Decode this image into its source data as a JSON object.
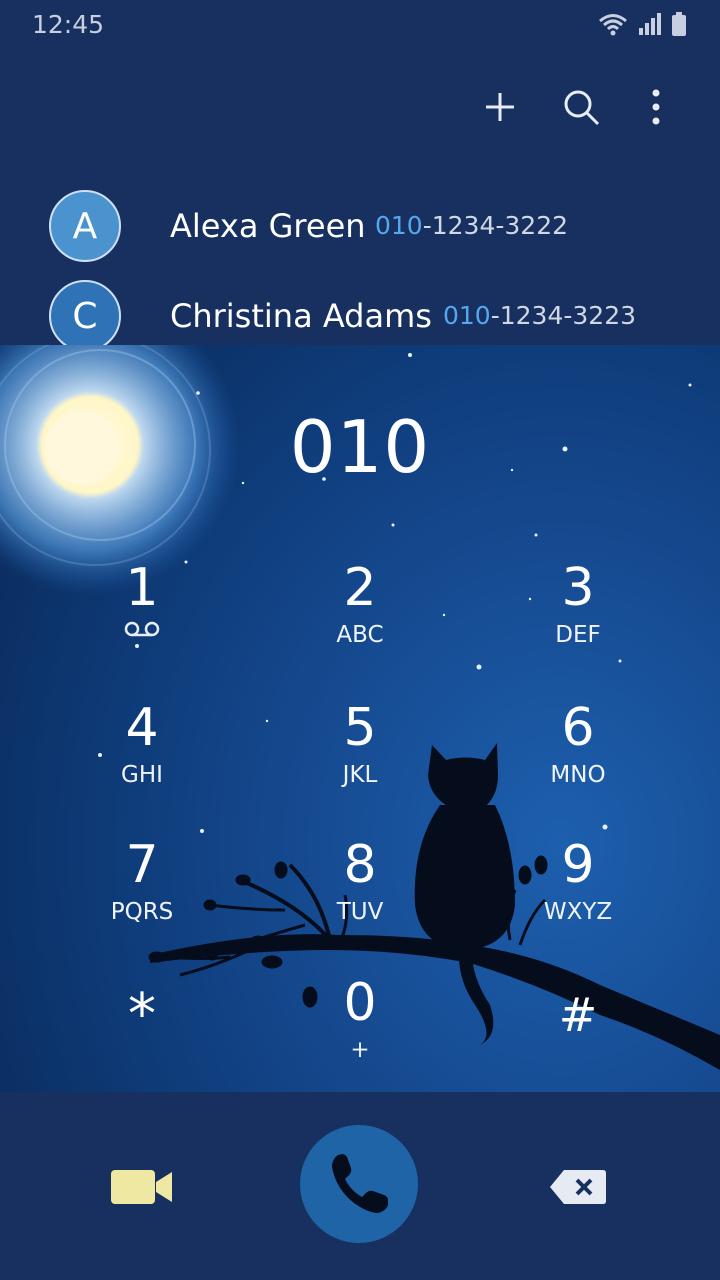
{
  "status_bar": {
    "time": "12:45"
  },
  "suggestions": [
    {
      "initial": "A",
      "name": "Alexa Green",
      "number_match": "010",
      "number_rest": "-1234-3222",
      "avatar_color": "#4a93cf"
    },
    {
      "initial": "C",
      "name": "Christina Adams",
      "number_match": "010",
      "number_rest": "-1234-3223",
      "avatar_color": "#2f73b6"
    }
  ],
  "dialer": {
    "entered": "010",
    "keys": [
      {
        "digit": "1",
        "letters": ""
      },
      {
        "digit": "2",
        "letters": "ABC"
      },
      {
        "digit": "3",
        "letters": "DEF"
      },
      {
        "digit": "4",
        "letters": "GHI"
      },
      {
        "digit": "5",
        "letters": "JKL"
      },
      {
        "digit": "6",
        "letters": "MNO"
      },
      {
        "digit": "7",
        "letters": "PQRS"
      },
      {
        "digit": "8",
        "letters": "TUV"
      },
      {
        "digit": "9",
        "letters": "WXYZ"
      },
      {
        "digit": "*",
        "letters": ""
      },
      {
        "digit": "0",
        "letters": "+"
      },
      {
        "digit": "#",
        "letters": ""
      }
    ]
  },
  "colors": {
    "bar_bg": "#17305f",
    "accent": "#55a7f0",
    "call_button": "#1f64a6",
    "video_icon": "#efe8a2"
  },
  "icons": {
    "top": [
      "add-icon",
      "search-icon",
      "more-options-icon"
    ],
    "bottom": [
      "video-call-icon",
      "phone-icon",
      "backspace-icon"
    ]
  }
}
